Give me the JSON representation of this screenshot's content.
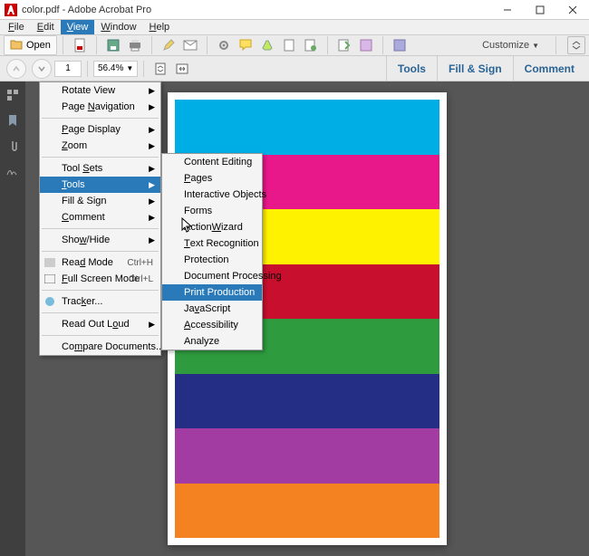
{
  "window": {
    "title": "color.pdf - Adobe Acrobat Pro"
  },
  "menubar": {
    "file": "File",
    "edit": "Edit",
    "view": "View",
    "window": "Window",
    "help": "Help",
    "underlines": {
      "file": "F",
      "edit": "E",
      "view": "V",
      "window": "W",
      "help": "H"
    }
  },
  "toolbar1": {
    "open": "Open",
    "customize": "Customize"
  },
  "toolbar2": {
    "page": "1",
    "zoom": "56.4%",
    "tabs": {
      "tools": "Tools",
      "fill": "Fill & Sign",
      "comment": "Comment"
    }
  },
  "viewMenu": {
    "rotate": "Rotate View",
    "pagenav": "Page Navigation",
    "pagedisplay": "Page Display",
    "zoom": "Zoom",
    "toolsets": "Tool Sets",
    "tools": "Tools",
    "fillsign": "Fill & Sign",
    "comment": "Comment",
    "showhide": "Show/Hide",
    "readmode": "Read Mode",
    "fullscreen": "Full Screen Mode",
    "tracker": "Tracker...",
    "readout": "Read Out Loud",
    "compare": "Compare Documents...",
    "sc_read": "Ctrl+H",
    "sc_full": "Ctrl+L"
  },
  "toolsMenu": {
    "content": "Content Editing",
    "pages": "Pages",
    "interactive": "Interactive Objects",
    "forms": "Forms",
    "action": "Action Wizard",
    "textrec": "Text Recognition",
    "protection": "Protection",
    "docproc": "Document Processing",
    "printprod": "Print Production",
    "javascript": "JavaScript",
    "accessibility": "Accessibility",
    "analyze": "Analyze"
  },
  "stripes": [
    "#00aee6",
    "#e8178a",
    "#fff200",
    "#c8102e",
    "#2e9b3f",
    "#232e84",
    "#a23ba2",
    "#f58220"
  ]
}
